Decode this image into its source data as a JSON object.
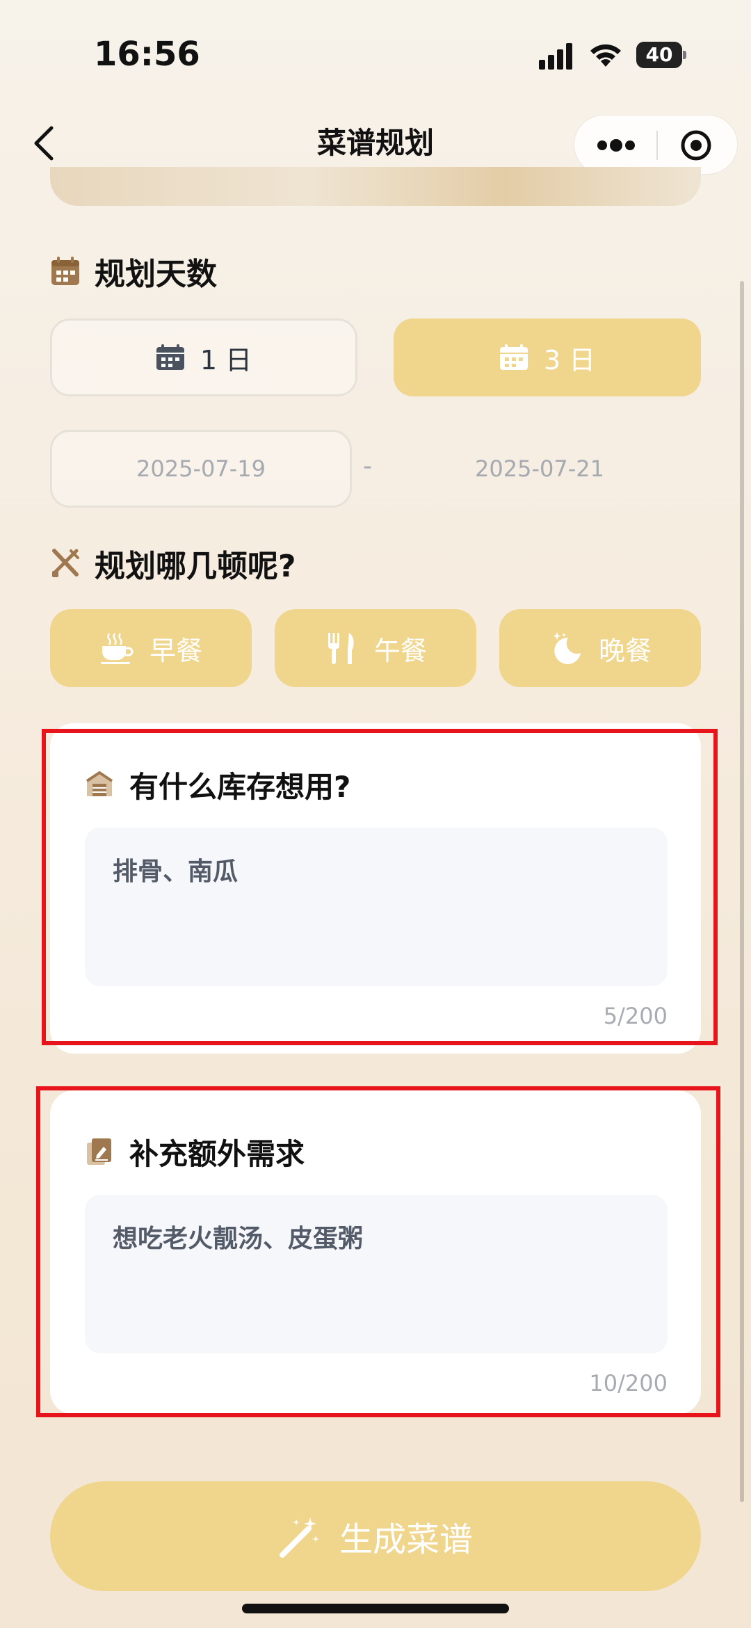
{
  "status_bar": {
    "time": "16:56",
    "battery": "40"
  },
  "nav": {
    "title": "菜谱规划"
  },
  "days_section": {
    "title": "规划天数",
    "options": [
      {
        "label": "1 日",
        "selected": false
      },
      {
        "label": "3 日",
        "selected": true
      }
    ],
    "start_date": "2025-07-19",
    "separator": "-",
    "end_date": "2025-07-21"
  },
  "meals_section": {
    "title": "规划哪几顿呢?",
    "meals": [
      {
        "label": "早餐",
        "icon": "coffee-cup-icon"
      },
      {
        "label": "午餐",
        "icon": "fork-knife-icon"
      },
      {
        "label": "晚餐",
        "icon": "moon-icon"
      }
    ]
  },
  "inventory_card": {
    "title": "有什么库存想用?",
    "value": "排骨、南瓜",
    "count": "5/200"
  },
  "extra_card": {
    "title": "补充额外需求",
    "value": "想吃老火靓汤、皮蛋粥",
    "count": "10/200"
  },
  "generate_button": {
    "label": "生成菜谱",
    "icon": "magic-wand-icon"
  },
  "colors": {
    "accent": "#f0d58d",
    "highlight": "#e8141b",
    "icon_brown": "#a07850"
  }
}
